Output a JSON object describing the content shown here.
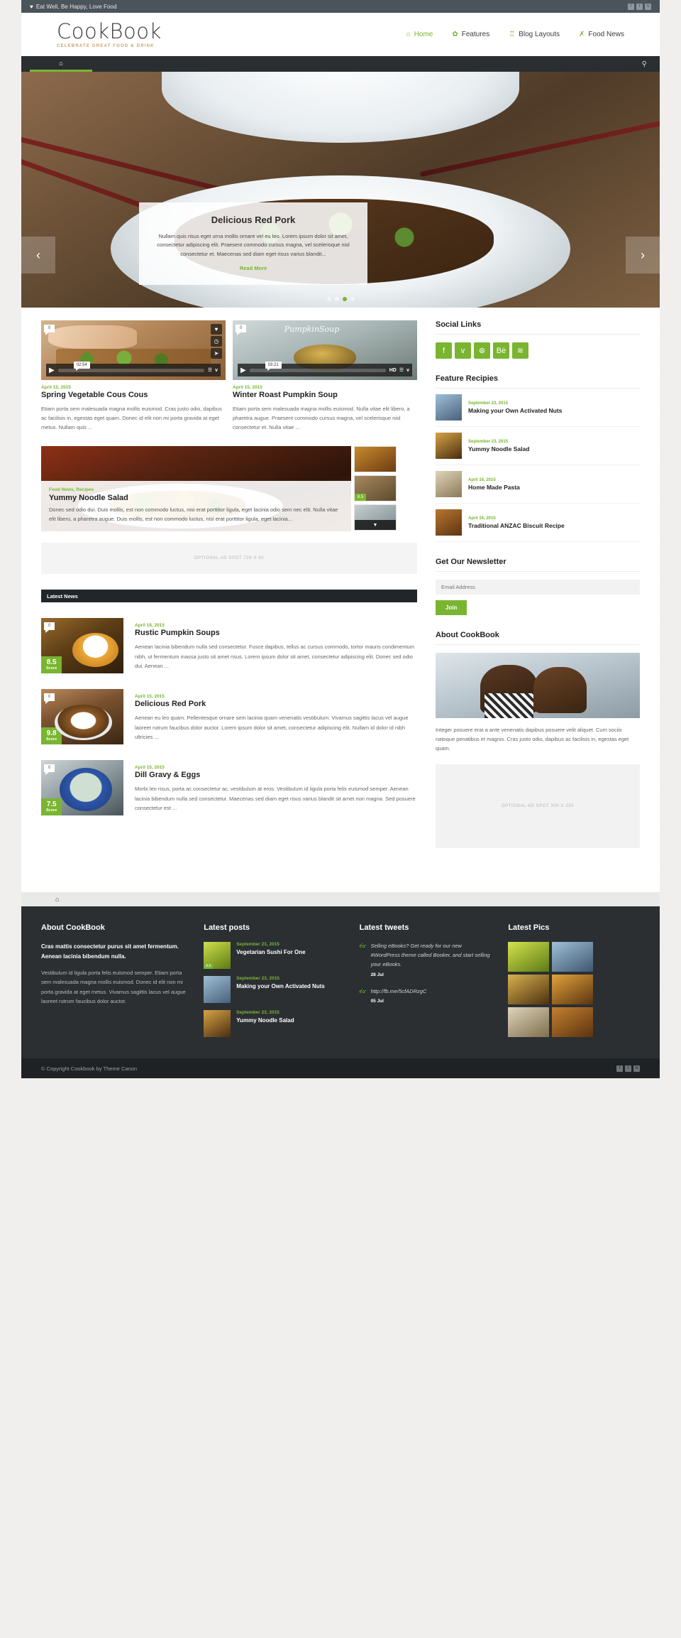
{
  "topbar": {
    "tagline": "Eat Well, Be Happy, Love Food",
    "socials": [
      "f",
      "t",
      "r"
    ]
  },
  "header": {
    "logo": "CookBook",
    "sublogo": "CELEBRATE GREAT FOOD & DRINK",
    "nav": [
      {
        "label": "Home",
        "icon": "home-icon",
        "glyph": "⌂",
        "active": true
      },
      {
        "label": "Features",
        "icon": "leaf-icon",
        "glyph": "✿",
        "active": false
      },
      {
        "label": "Blog Layouts",
        "icon": "cake-icon",
        "glyph": "♖",
        "active": false
      },
      {
        "label": "Food News",
        "icon": "cutlery-icon",
        "glyph": "✇",
        "active": false
      }
    ]
  },
  "subbar": {
    "home_glyph": "⌂",
    "search_glyph": "⌕"
  },
  "slider": {
    "title": "Delicious Red Pork",
    "text": "Nullam quis risus eget urna mollis ornare vel eu leo. Lorem ipsum dolor sit amet, consectetur adipiscing elit. Praesent commodo cursus magna, vel scelerisque nisl consectetur et. Maecenas sed diam eget risus varius blandit...",
    "readmore": "Read More",
    "prev": "‹",
    "next": "›",
    "dots": 4,
    "active_dot": 2
  },
  "video_posts": [
    {
      "comments": "0",
      "duration": "02:54",
      "hd": "",
      "date": "April 15, 2015",
      "title": "Spring Vegetable Cous Cous",
      "excerpt": "Etiam porta sem malesuada magna mollis euismod. Cras justo odio, dapibus ac facilisis in, egestas eget quam. Donec id elit non mi porta gravida at eget metus. Nullam quis ...",
      "source": "v",
      "tools": [
        "heart-icon",
        "clock-icon",
        "send-icon"
      ]
    },
    {
      "comments": "0",
      "duration": "03:21",
      "hd": "HD",
      "date": "April 15, 2015",
      "title": "Winter Roast Pumpkin Soup",
      "excerpt": "Etiam porta sem malesuada magna mollis euismod. Nulla vitae elit libero, a pharetra augue. Praesent commodo cursus magna, vel scelerisque nisl consectetur et. Nulla vitae ...",
      "source": "v",
      "script": "PumpkinSoup",
      "tools": []
    }
  ],
  "featured": {
    "category": "Food News, Recipes",
    "title": "Yummy Noodle Salad",
    "excerpt": "Donec sed odio dui. Duis mollis, est non commodo luctus, nisi erat porttitor ligula, eget lacinia odio sem nec elit. Nulla vitae elit libero, a pharetra augue. Duis mollis, est non commodo luctus, nisi erat porttitor ligula, eget lacinia...",
    "side_scores": [
      "",
      "8.5",
      ""
    ],
    "down_glyph": "▼"
  },
  "ad_inline": "OPTIONAL AD SPOT 728 X 90",
  "latest_news_bar": "Latest News",
  "news": [
    {
      "comments": "0",
      "score": "8.5",
      "score_label": "Score",
      "date": "April 18, 2015",
      "title": "Rustic Pumpkin Soups",
      "excerpt": "Aenean lacinia bibendum nulla sed consectetur. Fusce dapibus, tellus ac cursus commodo, tortor mauris condimentum nibh, ut fermentum massa justo sit amet risus. Lorem ipsum dolor sit amet, consectetur adipiscing elit. Donec sed odio dui. Aenean ..."
    },
    {
      "comments": "0",
      "score": "9.8",
      "score_label": "Score",
      "date": "April 15, 2015",
      "title": "Delicious Red Pork",
      "excerpt": "Aenean eu leo quam. Pellentesque ornare sem lacinia quam venenatis vestibulum. Vivamus sagittis lacus vel augue laoreet rutrum faucibus dolor auctor. Lorem ipsum dolor sit amet, consectetur adipiscing elit. Nullam id dolor id nibh ultricies ..."
    },
    {
      "comments": "0",
      "score": "7.5",
      "score_label": "Score",
      "date": "April 15, 2015",
      "title": "Dill Gravy & Eggs",
      "excerpt": "Morbi leo risus, porta ac consectetur ac, vestibulum at eros. Vestibulum id ligula porta felis euismod semper. Aenean lacinia bibendum nulla sed consectetur. Maecenas sed diam eget risus varius blandit sit amet non magna. Sed posuere consectetur est ..."
    }
  ],
  "sidebar": {
    "social_title": "Social Links",
    "social_links": [
      {
        "icon": "facebook-icon",
        "glyph": "f"
      },
      {
        "icon": "twitter-icon",
        "glyph": "ᴠ"
      },
      {
        "icon": "dribbble-icon",
        "glyph": "⊛"
      },
      {
        "icon": "behance-icon",
        "glyph": "Bė"
      },
      {
        "icon": "rss-icon",
        "glyph": "≋"
      }
    ],
    "recipes_title": "Feature Recipies",
    "recipes": [
      {
        "date": "September 23, 2015",
        "title": "Making your Own Activated Nuts"
      },
      {
        "date": "September 23, 2015",
        "title": "Yummy Noodle Salad"
      },
      {
        "date": "April 16, 2015",
        "title": "Home Made Pasta"
      },
      {
        "date": "April 16, 2015",
        "title": "Traditional ANZAC Biscuit Recipe"
      }
    ],
    "newsletter_title": "Get Our Newsletter",
    "email_placeholder": "Email Address",
    "join_label": "Join",
    "about_title": "About CookBook",
    "about_text": "Integer posuere erat a ante venenatis dapibus posuere velit aliquet. Cum sociis natoque penatibus et magnis. Cras justo odio, dapibus ac facilisis in, egestas eget quam.",
    "ad_box": "OPTIONAL AD SPOT 300 X 250"
  },
  "footer": {
    "home_glyph": "⌂",
    "about_title": "About CookBook",
    "about_bold": "Cras mattis consectetur purus sit amet fermentum. Aenean lacinia bibendum nulla.",
    "about_body": "Vestibulum id ligula porta felis euismod semper. Etiam porta sem malesuada magna mollis euismod. Donec id elit non mi porta gravida at eget metus. Vivamus sagittis lacus vel augue laoreet rutrum faucibus dolor auctor.",
    "posts_title": "Latest posts",
    "posts": [
      {
        "date": "September 23, 2015",
        "title": "Vegetarian Sushi For One",
        "score": "9.9"
      },
      {
        "date": "September 23, 2015",
        "title": "Making your Own Activated Nuts",
        "score": ""
      },
      {
        "date": "September 23, 2015",
        "title": "Yummy Noodle Salad",
        "score": ""
      }
    ],
    "tweets_title": "Latest tweets",
    "tweets": [
      {
        "text": "Selling eBooks? Get ready for our new #WordPress theme called Booker, and start selling your eBooks.",
        "date": "28 Jul"
      },
      {
        "text": "http://fb.me/5cfADRzgC",
        "date": "05 Jul"
      }
    ],
    "pics_title": "Latest Pics",
    "pics_count": 6,
    "copyright": "© Copyright Cookbook by Theme Canon",
    "copy_socials": [
      "f",
      "t",
      "r"
    ]
  },
  "colors": {
    "accent": "#79b530",
    "dark": "#2b2f32",
    "topbar": "#4c545b",
    "gold": "#c8a46a"
  }
}
